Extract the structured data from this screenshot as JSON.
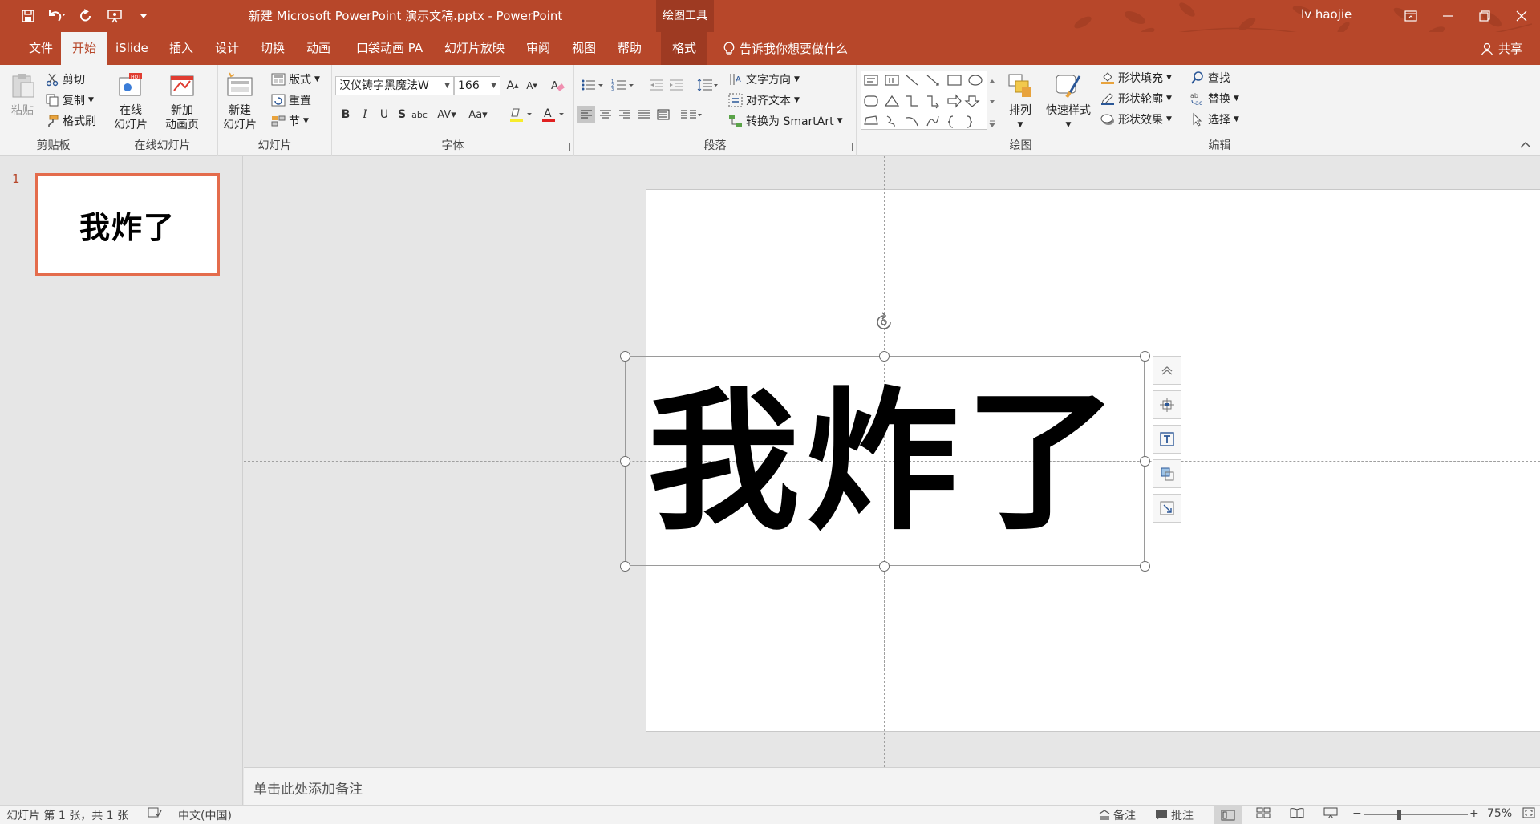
{
  "window": {
    "title": "新建 Microsoft PowerPoint 演示文稿.pptx  -  PowerPoint",
    "tools_label": "绘图工具",
    "user": "lv haojie"
  },
  "tabs": [
    "文件",
    "开始",
    "iSlide",
    "插入",
    "设计",
    "切换",
    "动画",
    "口袋动画 PA",
    "幻灯片放映",
    "审阅",
    "视图",
    "帮助",
    "格式"
  ],
  "tell_me": "告诉我你想要做什么",
  "share": "共享",
  "ribbon": {
    "clipboard": {
      "label": "剪贴板",
      "paste": "粘贴",
      "cut": "剪切",
      "copy": "复制",
      "format_painter": "格式刷"
    },
    "online": {
      "label": "在线幻灯片",
      "online_slides": [
        "在线",
        "幻灯片"
      ],
      "new_anim": [
        "新加",
        "动画页"
      ]
    },
    "slides": {
      "label": "幻灯片",
      "new_slide": [
        "新建",
        "幻灯片"
      ],
      "layout": "版式",
      "reset": "重置",
      "section": "节"
    },
    "font": {
      "label": "字体",
      "font_name": "汉仪铸字黑魔法W",
      "font_size": "166"
    },
    "paragraph": {
      "label": "段落",
      "text_direction": "文字方向",
      "align_text": "对齐文本",
      "smartart": "转换为 SmartArt"
    },
    "drawing": {
      "label": "绘图",
      "arrange": "排列",
      "quick_styles": "快速样式",
      "shape_fill": "形状填充",
      "shape_outline": "形状轮廓",
      "shape_effects": "形状效果"
    },
    "editing": {
      "label": "编辑",
      "find": "查找",
      "replace": "替换",
      "select": "选择"
    }
  },
  "thumbnail": {
    "number": "1",
    "text": "我炸了"
  },
  "slide": {
    "text": "我炸了"
  },
  "notes_placeholder": "单击此处添加备注",
  "status": {
    "slide_info": "幻灯片 第 1 张，共 1 张",
    "language": "中文(中国)",
    "notes": "备注",
    "comments": "批注",
    "zoom": "75%"
  },
  "colors": {
    "accent": "#b7472a",
    "thumb_border": "#e46c4c"
  }
}
